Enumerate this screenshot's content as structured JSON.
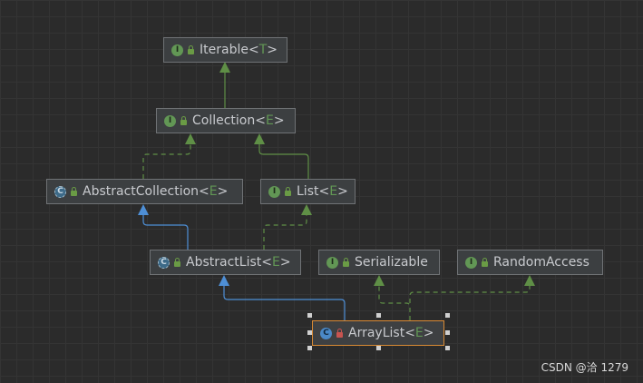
{
  "nodes": [
    {
      "id": "iterable",
      "name": "Iterable",
      "type_param": "T",
      "badge": "I",
      "kind": "interface"
    },
    {
      "id": "collection",
      "name": "Collection",
      "type_param": "E",
      "badge": "I",
      "kind": "interface"
    },
    {
      "id": "abstract_collection",
      "name": "AbstractCollection",
      "type_param": "E",
      "badge": "C",
      "kind": "abstract-class"
    },
    {
      "id": "list",
      "name": "List",
      "type_param": "E",
      "badge": "I",
      "kind": "interface"
    },
    {
      "id": "abstract_list",
      "name": "AbstractList",
      "type_param": "E",
      "badge": "C",
      "kind": "abstract-class"
    },
    {
      "id": "serializable",
      "name": "Serializable",
      "type_param": "",
      "badge": "I",
      "kind": "interface"
    },
    {
      "id": "random_access",
      "name": "RandomAccess",
      "type_param": "",
      "badge": "I",
      "kind": "interface"
    },
    {
      "id": "array_list",
      "name": "ArrayList",
      "type_param": "E",
      "badge": "C",
      "kind": "class",
      "selected": true
    }
  ],
  "edges": [
    {
      "from": "collection",
      "to": "iterable",
      "relation": "extends"
    },
    {
      "from": "abstract_collection",
      "to": "collection",
      "relation": "implements"
    },
    {
      "from": "list",
      "to": "collection",
      "relation": "extends"
    },
    {
      "from": "abstract_list",
      "to": "abstract_collection",
      "relation": "extends"
    },
    {
      "from": "abstract_list",
      "to": "list",
      "relation": "implements"
    },
    {
      "from": "array_list",
      "to": "abstract_list",
      "relation": "extends"
    },
    {
      "from": "array_list",
      "to": "serializable",
      "relation": "implements"
    },
    {
      "from": "array_list",
      "to": "random_access",
      "relation": "implements"
    }
  ],
  "colors": {
    "extends_interface": "#5f8f46",
    "extends_class": "#4e8fd6",
    "implements": "#5f8f46",
    "selected_border": "#d98a34"
  },
  "watermark": "CSDN @洽 1279"
}
